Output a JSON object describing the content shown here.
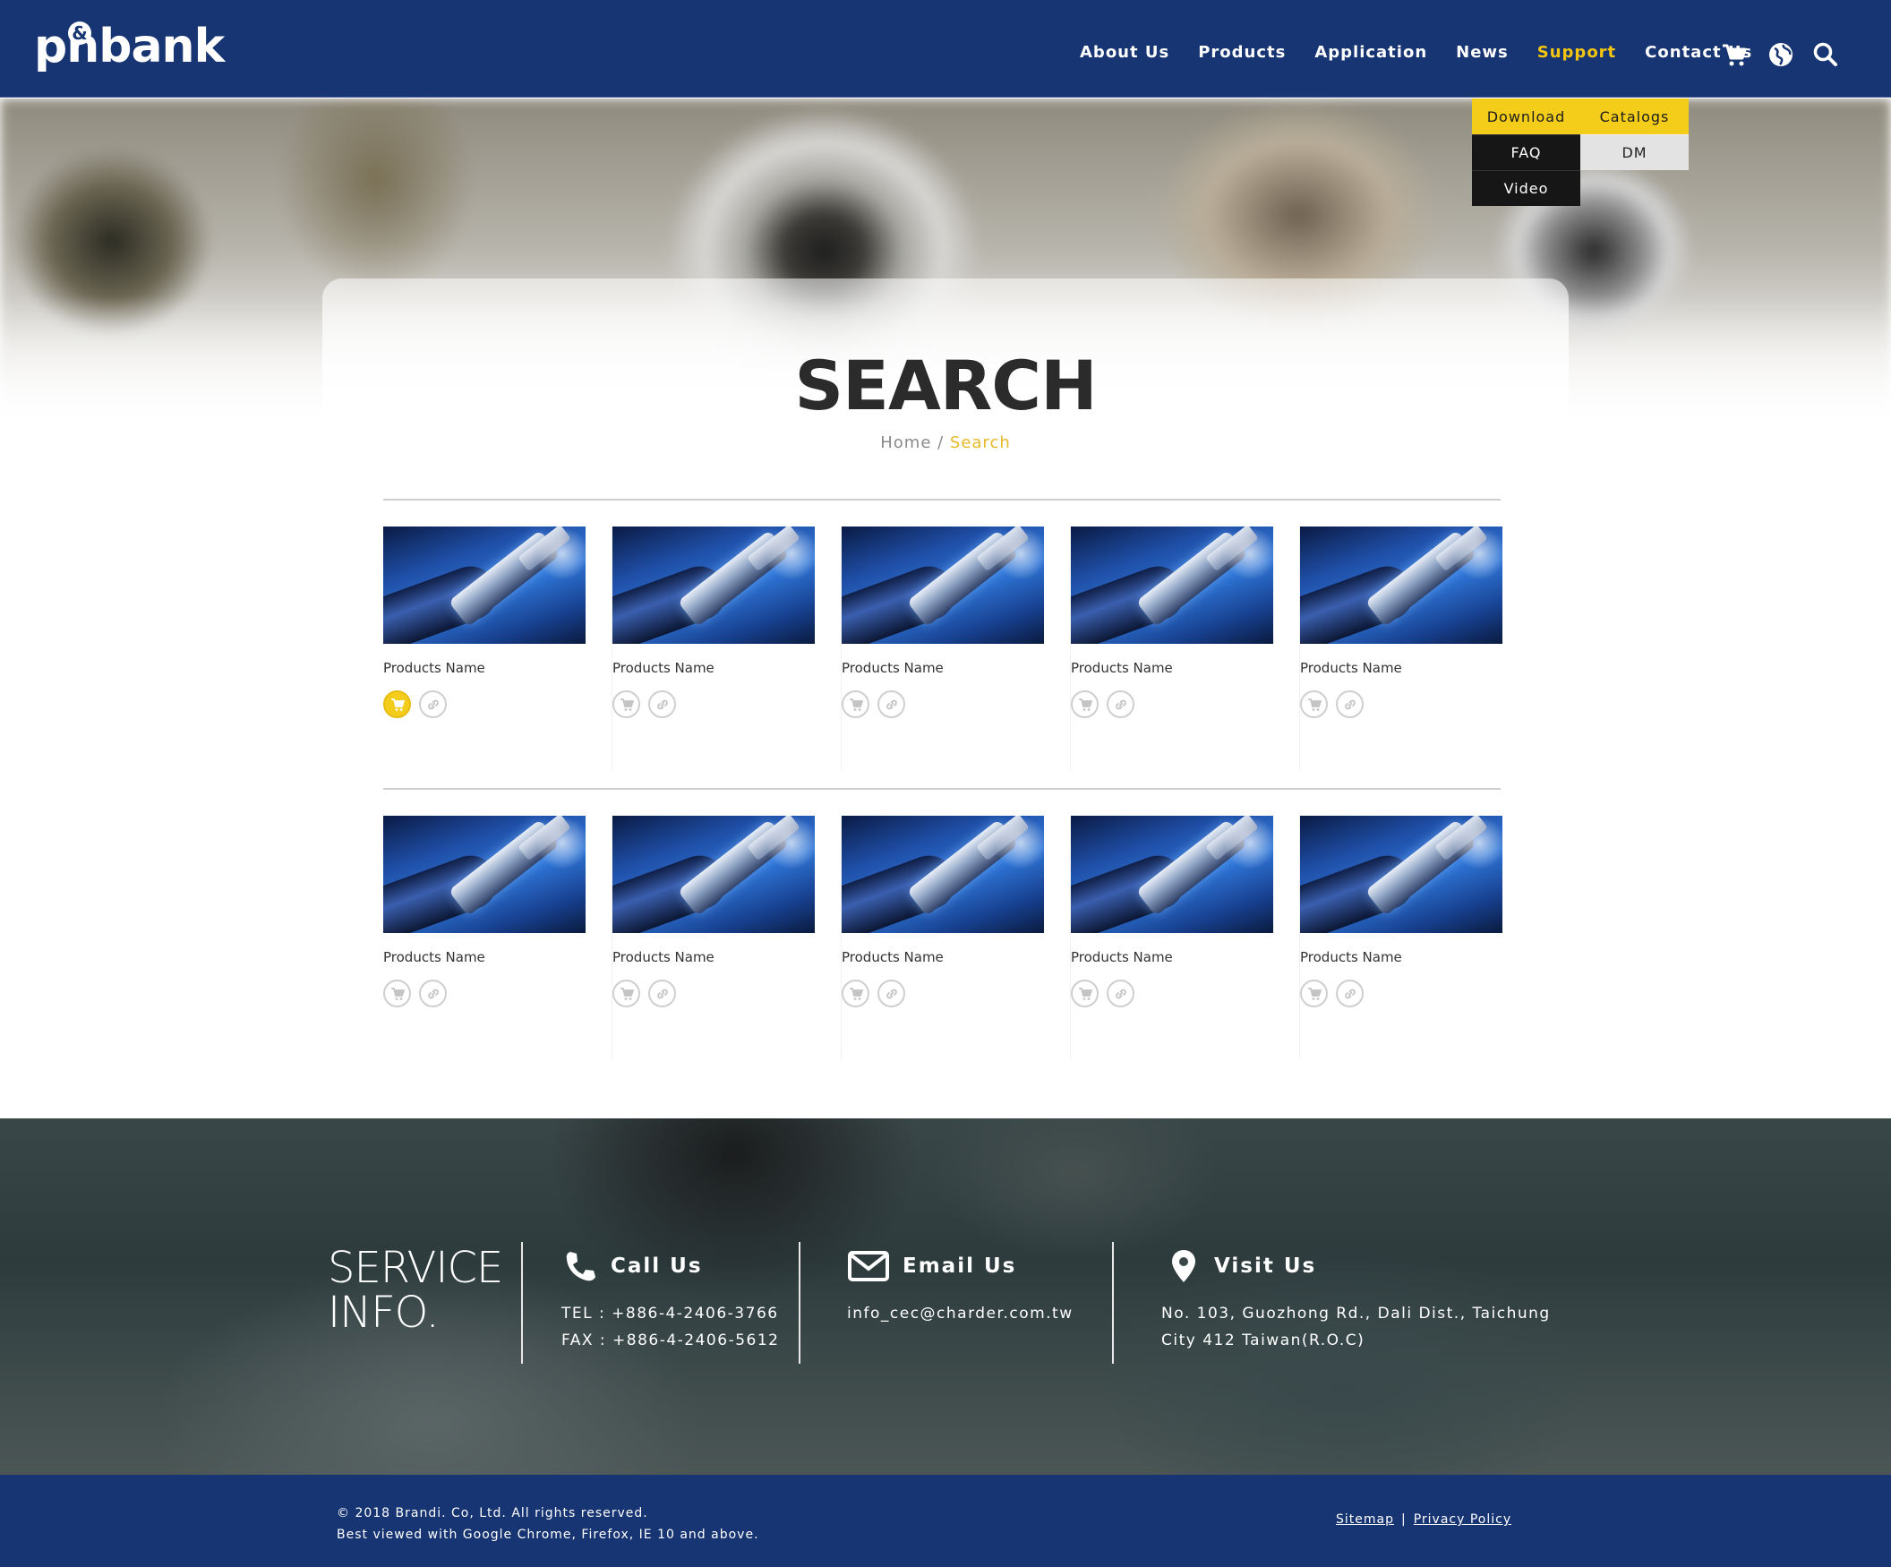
{
  "brand": {
    "logo_text": "pnbank",
    "logo_amp": "&"
  },
  "nav": {
    "items": [
      {
        "label": "About Us"
      },
      {
        "label": "Products"
      },
      {
        "label": "Application"
      },
      {
        "label": "News"
      },
      {
        "label": "Support",
        "active": true
      },
      {
        "label": "Contact Us"
      }
    ],
    "icons": [
      "cart-icon",
      "globe-icon",
      "search-icon"
    ],
    "active_color": "#f5c60f",
    "bar_color": "#173473"
  },
  "support_menu": {
    "items": [
      "Download",
      "Catalogs",
      "FAQ",
      "DM",
      "Video"
    ]
  },
  "page": {
    "title": "SEARCH",
    "breadcrumb_home": "Home",
    "breadcrumb_sep": " / ",
    "breadcrumb_current": "Search"
  },
  "results": {
    "rows": [
      [
        {
          "name": "Products Name",
          "cart_active": true
        },
        {
          "name": "Products Name",
          "cart_active": false
        },
        {
          "name": "Products Name",
          "cart_active": false
        },
        {
          "name": "Products Name",
          "cart_active": false
        },
        {
          "name": "Products Name",
          "cart_active": false
        }
      ],
      [
        {
          "name": "Products Name",
          "cart_active": false
        },
        {
          "name": "Products Name",
          "cart_active": false
        },
        {
          "name": "Products Name",
          "cart_active": false
        },
        {
          "name": "Products Name",
          "cart_active": false
        },
        {
          "name": "Products Name",
          "cart_active": false
        }
      ]
    ],
    "action_icons": [
      "cart-icon",
      "link-icon"
    ],
    "accent_color": "#f4cc1a"
  },
  "service": {
    "title_line1": "SERVICE",
    "title_line2": "INFO.",
    "call": {
      "heading": "Call Us",
      "tel": "TEL : +886-4-2406-3766",
      "fax": "FAX : +886-4-2406-5612"
    },
    "email": {
      "heading": "Email Us",
      "address": "info_cec@charder.com.tw"
    },
    "visit": {
      "heading": "Visit Us",
      "line1": "No. 103, Guozhong Rd., Dali Dist., Taichung",
      "line2": "City 412 Taiwan(R.O.C)"
    }
  },
  "footer": {
    "copyright": "© 2018 Brandi. Co, Ltd. All rights reserved.",
    "browser_note": "Best viewed with Google Chrome, Firefox, IE 10 and above.",
    "sitemap": "Sitemap",
    "separator": "|",
    "privacy": "Privacy Policy"
  }
}
